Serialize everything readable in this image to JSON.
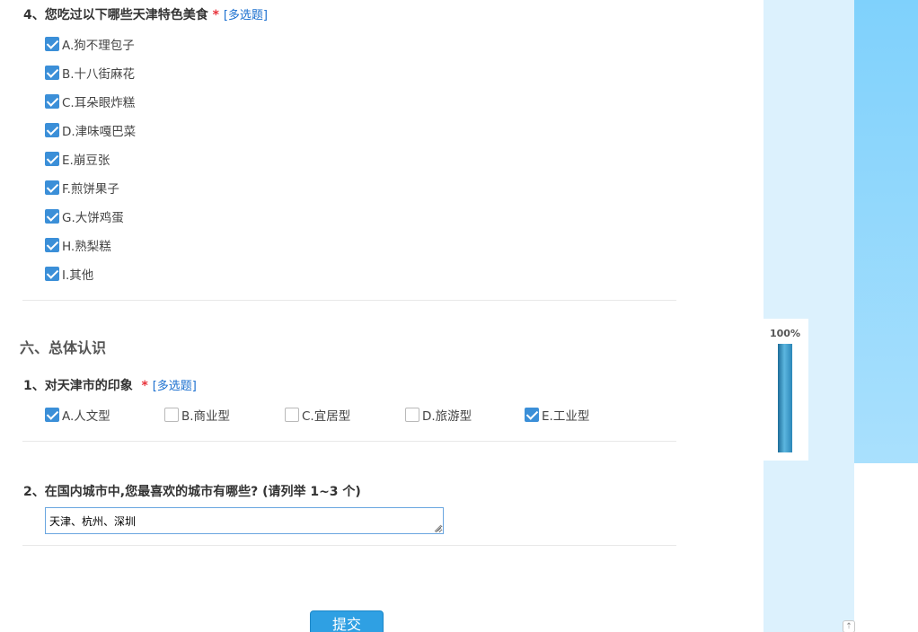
{
  "q4": {
    "number": "4、",
    "title": "您吃过以下哪些天津特色美食",
    "required_mark": "*",
    "multi_tag": "[多选题]",
    "options": [
      {
        "label": "A.狗不理包子",
        "checked": true
      },
      {
        "label": "B.十八街麻花",
        "checked": true
      },
      {
        "label": "C.耳朵眼炸糕",
        "checked": true
      },
      {
        "label": "D.津味嘎巴菜",
        "checked": true
      },
      {
        "label": "E.崩豆张",
        "checked": true
      },
      {
        "label": "F.煎饼果子",
        "checked": true
      },
      {
        "label": "G.大饼鸡蛋",
        "checked": true
      },
      {
        "label": "H.熟梨糕",
        "checked": true
      },
      {
        "label": "I.其他",
        "checked": true
      }
    ]
  },
  "section6": {
    "title": "六、总体认识"
  },
  "q1": {
    "number": "1、",
    "title": "对天津市的印象",
    "required_mark": "*",
    "multi_tag": "[多选题]",
    "options": [
      {
        "label": "A.人文型",
        "checked": true
      },
      {
        "label": "B.商业型",
        "checked": false
      },
      {
        "label": "C.宜居型",
        "checked": false
      },
      {
        "label": "D.旅游型",
        "checked": false
      },
      {
        "label": "E.工业型",
        "checked": true
      }
    ]
  },
  "q2": {
    "number": "2、",
    "title": "在国内城市中,您最喜欢的城市有哪些? (请列举 1~3 个)",
    "answer": "天津、杭州、深圳"
  },
  "submit_label": "提交",
  "progress": {
    "label": "100%",
    "value": 1.0
  },
  "colors": {
    "accent": "#2fa0e3",
    "checkbox_checked": "#3b8fd8",
    "required": "#e8333b",
    "multi_tag": "#1a6fcf",
    "progress_panel_bg": "#dcf1fd",
    "right_panel_bg": "#7fd1fc"
  }
}
